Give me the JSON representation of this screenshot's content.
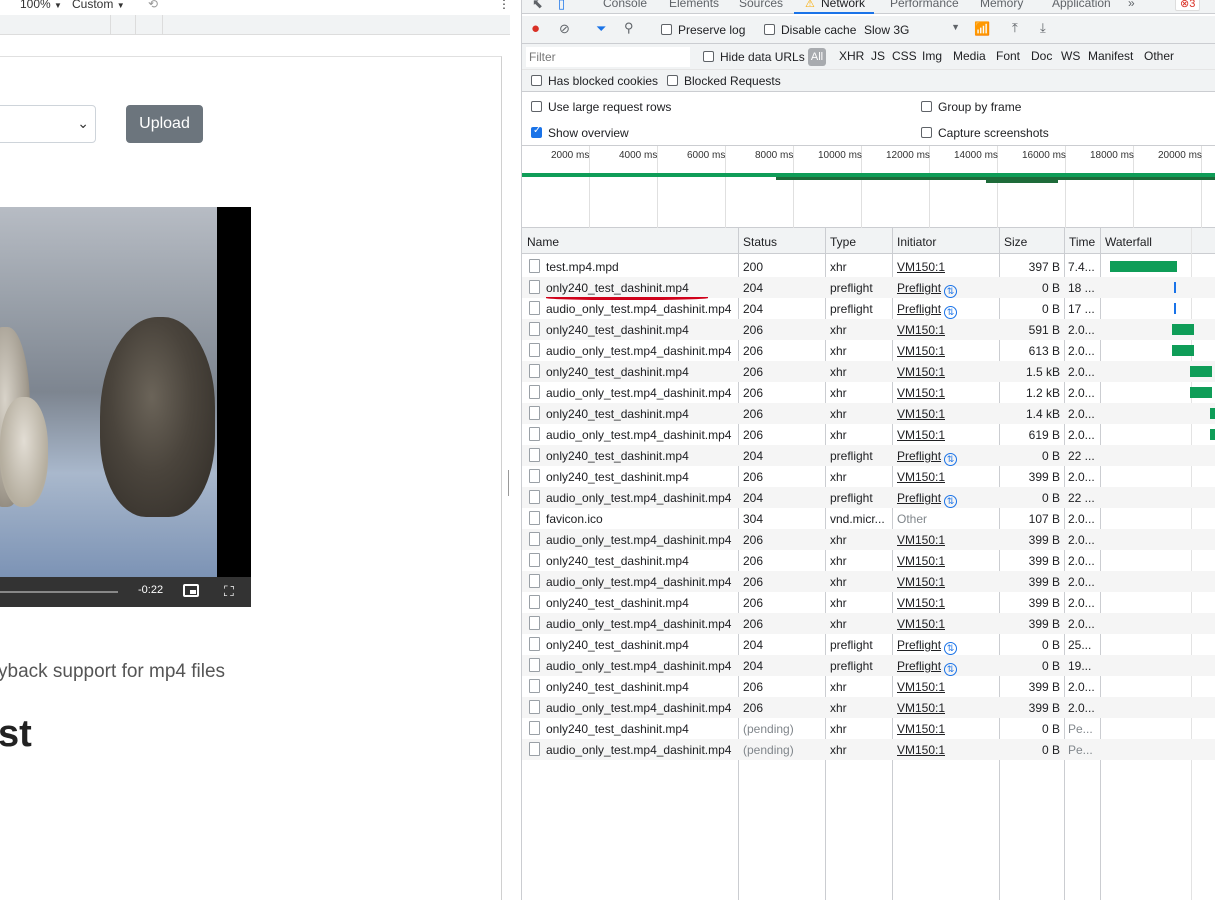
{
  "browser_bar": {
    "zoom": "100%",
    "zoom_arrow": "▼",
    "device": "Custom",
    "device_arrow": "▼",
    "rotate_icon": "⟲",
    "more_icon": "⋮"
  },
  "left_page": {
    "upload_label": "Upload",
    "select_chevron": "⌄",
    "video_time": "-0:22",
    "fullscreen_icon": "⛶",
    "description_fragment": "yback support for mp4 files",
    "heading_fragment": "st"
  },
  "devtools": {
    "tabs": [
      "Console",
      "Elements",
      "Sources",
      "Network",
      "Performance",
      "Memory",
      "Application"
    ],
    "active_tab": "Network",
    "more_tabs": "»",
    "error_count": "3",
    "toolbar": {
      "preserve_log": "Preserve log",
      "disable_cache": "Disable cache",
      "throttling": "Slow 3G",
      "throttling_arrow": "▼",
      "record_icon": "●",
      "clear_icon": "⊘",
      "filter_icon": "⏷",
      "search_icon": "⚲",
      "wifi_icon": "📶",
      "upload_icon": "⤒",
      "download_icon": "⤓"
    },
    "filter_bar": {
      "placeholder": "Filter",
      "hide_data_urls": "Hide data URLs",
      "all": "All",
      "types": [
        "XHR",
        "JS",
        "CSS",
        "Img",
        "Media",
        "Font",
        "Doc",
        "WS",
        "Manifest",
        "Other"
      ]
    },
    "blocked_bar": {
      "has_blocked_cookies": "Has blocked cookies",
      "blocked_requests": "Blocked Requests"
    },
    "settings": {
      "use_large_rows": "Use large request rows",
      "show_overview": "Show overview",
      "show_overview_checked": true,
      "group_by_frame": "Group by frame",
      "capture_screenshots": "Capture screenshots"
    },
    "overview_ticks": [
      "2000 ms",
      "4000 ms",
      "6000 ms",
      "8000 ms",
      "10000 ms",
      "12000 ms",
      "14000 ms",
      "16000 ms",
      "18000 ms",
      "20000 ms"
    ],
    "columns": [
      "Name",
      "Status",
      "Type",
      "Initiator",
      "Size",
      "Time",
      "Waterfall"
    ],
    "rows": [
      {
        "name": "test.mp4.mpd",
        "status": "200",
        "type": "xhr",
        "initiator": "VM150:1",
        "init_kind": "link",
        "size": "397 B",
        "time": "7.4..."
      },
      {
        "name": "only240_test_dashinit.mp4",
        "status": "204",
        "type": "preflight",
        "initiator": "Preflight",
        "init_kind": "preflight",
        "size": "0 B",
        "time": "18 ..."
      },
      {
        "name": "audio_only_test.mp4_dashinit.mp4",
        "status": "204",
        "type": "preflight",
        "initiator": "Preflight",
        "init_kind": "preflight",
        "size": "0 B",
        "time": "17 ..."
      },
      {
        "name": "only240_test_dashinit.mp4",
        "status": "206",
        "type": "xhr",
        "initiator": "VM150:1",
        "init_kind": "link",
        "size": "591 B",
        "time": "2.0..."
      },
      {
        "name": "audio_only_test.mp4_dashinit.mp4",
        "status": "206",
        "type": "xhr",
        "initiator": "VM150:1",
        "init_kind": "link",
        "size": "613 B",
        "time": "2.0..."
      },
      {
        "name": "only240_test_dashinit.mp4",
        "status": "206",
        "type": "xhr",
        "initiator": "VM150:1",
        "init_kind": "link",
        "size": "1.5 kB",
        "time": "2.0..."
      },
      {
        "name": "audio_only_test.mp4_dashinit.mp4",
        "status": "206",
        "type": "xhr",
        "initiator": "VM150:1",
        "init_kind": "link",
        "size": "1.2 kB",
        "time": "2.0..."
      },
      {
        "name": "only240_test_dashinit.mp4",
        "status": "206",
        "type": "xhr",
        "initiator": "VM150:1",
        "init_kind": "link",
        "size": "1.4 kB",
        "time": "2.0..."
      },
      {
        "name": "audio_only_test.mp4_dashinit.mp4",
        "status": "206",
        "type": "xhr",
        "initiator": "VM150:1",
        "init_kind": "link",
        "size": "619 B",
        "time": "2.0..."
      },
      {
        "name": "only240_test_dashinit.mp4",
        "status": "204",
        "type": "preflight",
        "initiator": "Preflight",
        "init_kind": "preflight",
        "size": "0 B",
        "time": "22 ..."
      },
      {
        "name": "only240_test_dashinit.mp4",
        "status": "206",
        "type": "xhr",
        "initiator": "VM150:1",
        "init_kind": "link",
        "size": "399 B",
        "time": "2.0..."
      },
      {
        "name": "audio_only_test.mp4_dashinit.mp4",
        "status": "204",
        "type": "preflight",
        "initiator": "Preflight",
        "init_kind": "preflight",
        "size": "0 B",
        "time": "22 ..."
      },
      {
        "name": "favicon.ico",
        "status": "304",
        "type": "vnd.micr...",
        "initiator": "Other",
        "init_kind": "muted",
        "size": "107 B",
        "time": "2.0..."
      },
      {
        "name": "audio_only_test.mp4_dashinit.mp4",
        "status": "206",
        "type": "xhr",
        "initiator": "VM150:1",
        "init_kind": "link",
        "size": "399 B",
        "time": "2.0..."
      },
      {
        "name": "only240_test_dashinit.mp4",
        "status": "206",
        "type": "xhr",
        "initiator": "VM150:1",
        "init_kind": "link",
        "size": "399 B",
        "time": "2.0..."
      },
      {
        "name": "audio_only_test.mp4_dashinit.mp4",
        "status": "206",
        "type": "xhr",
        "initiator": "VM150:1",
        "init_kind": "link",
        "size": "399 B",
        "time": "2.0..."
      },
      {
        "name": "only240_test_dashinit.mp4",
        "status": "206",
        "type": "xhr",
        "initiator": "VM150:1",
        "init_kind": "link",
        "size": "399 B",
        "time": "2.0..."
      },
      {
        "name": "audio_only_test.mp4_dashinit.mp4",
        "status": "206",
        "type": "xhr",
        "initiator": "VM150:1",
        "init_kind": "link",
        "size": "399 B",
        "time": "2.0..."
      },
      {
        "name": "only240_test_dashinit.mp4",
        "status": "204",
        "type": "preflight",
        "initiator": "Preflight",
        "init_kind": "preflight",
        "size": "0 B",
        "time": "25..."
      },
      {
        "name": "audio_only_test.mp4_dashinit.mp4",
        "status": "204",
        "type": "preflight",
        "initiator": "Preflight",
        "init_kind": "preflight",
        "size": "0 B",
        "time": "19..."
      },
      {
        "name": "only240_test_dashinit.mp4",
        "status": "206",
        "type": "xhr",
        "initiator": "VM150:1",
        "init_kind": "link",
        "size": "399 B",
        "time": "2.0..."
      },
      {
        "name": "audio_only_test.mp4_dashinit.mp4",
        "status": "206",
        "type": "xhr",
        "initiator": "VM150:1",
        "init_kind": "link",
        "size": "399 B",
        "time": "2.0..."
      },
      {
        "name": "only240_test_dashinit.mp4",
        "status": "(pending)",
        "type": "xhr",
        "initiator": "VM150:1",
        "init_kind": "link",
        "size": "0 B",
        "time": "Pe..."
      },
      {
        "name": "audio_only_test.mp4_dashinit.mp4",
        "status": "(pending)",
        "type": "xhr",
        "initiator": "VM150:1",
        "init_kind": "link",
        "size": "0 B",
        "time": "Pe..."
      }
    ],
    "colors": {
      "record": "#d93025",
      "accent": "#1a73e8",
      "waterfall": "#0f9d58",
      "annotation": "#d0021b"
    }
  }
}
